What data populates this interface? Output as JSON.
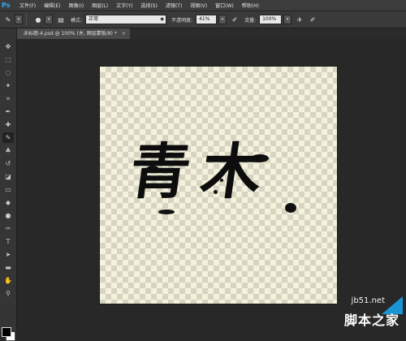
{
  "app": {
    "logo": "Ps"
  },
  "menu": [
    "文件(F)",
    "编辑(E)",
    "图像(I)",
    "图层(L)",
    "文字(Y)",
    "选择(S)",
    "滤镜(T)",
    "视图(V)",
    "窗口(W)",
    "帮助(H)"
  ],
  "options": {
    "brush_size": "",
    "mode_label": "模式:",
    "mode_value": "正常",
    "opacity_label": "不透明度:",
    "opacity_value": "41%",
    "flow_label": "流量:",
    "flow_value": "100%"
  },
  "document": {
    "tab_title": "未标题-4.psd @ 100% (木, 图层蒙版/8) *",
    "artwork_text": "青木"
  },
  "watermark": {
    "url": "jb51.net",
    "text": "脚本之家"
  },
  "colors": {
    "foreground": "#000000",
    "background": "#ffffff",
    "accent": "#31a8ff"
  }
}
